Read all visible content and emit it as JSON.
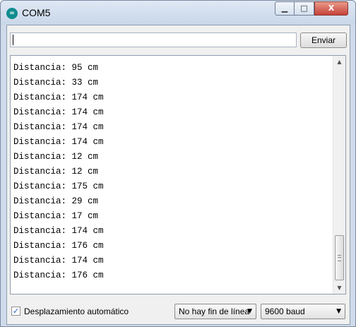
{
  "window": {
    "title": "COM5",
    "controls": {
      "minimize": "▁",
      "maximize": "□",
      "close": "X"
    }
  },
  "send": {
    "input_value": "",
    "button_label": "Enviar"
  },
  "output": {
    "lines": [
      "Distancia: 95 cm",
      "Distancia: 33 cm",
      "Distancia: 174 cm",
      "Distancia: 174 cm",
      "Distancia: 174 cm",
      "Distancia: 174 cm",
      "Distancia: 12 cm",
      "Distancia: 12 cm",
      "Distancia: 175 cm",
      "Distancia: 29 cm",
      "Distancia: 17 cm",
      "Distancia: 174 cm",
      "Distancia: 176 cm",
      "Distancia: 174 cm",
      "Distancia: 176 cm"
    ],
    "scroll_position_fraction": 0.85
  },
  "footer": {
    "autoscroll_checked": true,
    "autoscroll_label": "Desplazamiento automático",
    "line_ending_selected": "No hay fin de línea",
    "baud_selected": "9600 baud"
  },
  "icons": {
    "app": "arduino-infinity-icon",
    "dropdown": "chevron-down-icon"
  }
}
